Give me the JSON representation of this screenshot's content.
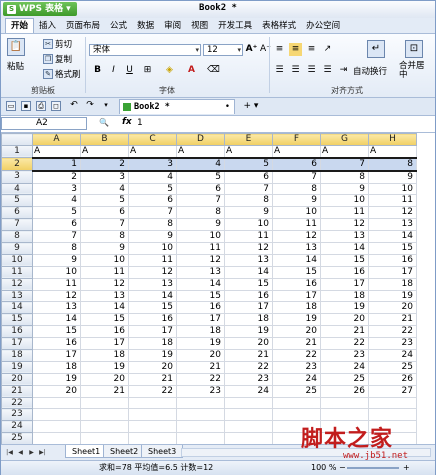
{
  "app": {
    "brand": "WPS 表格",
    "logo_letter": "S",
    "dropdown": "▾",
    "document_title": "Book2 *"
  },
  "menu": [
    "开始",
    "插入",
    "页面布局",
    "公式",
    "数据",
    "审阅",
    "视图",
    "开发工具",
    "表格样式",
    "办公空间"
  ],
  "ribbon": {
    "clipboard": {
      "paste": "粘贴",
      "cut": "剪切",
      "copy": "复制",
      "format_painter": "格式刷",
      "group": "剪贴板"
    },
    "font": {
      "name": "宋体",
      "size": "12",
      "bold": "B",
      "italic": "I",
      "underline": "U",
      "font_color_letter": "A",
      "grow": "A⁺",
      "shrink": "A⁻",
      "group": "字体"
    },
    "alignment": {
      "wrap": "自动换行",
      "merge": "合并居中",
      "group": "对齐方式"
    }
  },
  "doc_tab": {
    "title": "Book2 *",
    "close": "•",
    "new": "+ ▾"
  },
  "formula": {
    "cell_ref": "A2",
    "zoom_icon": "🔍",
    "fx": "fx",
    "value": "1"
  },
  "columns": [
    "A",
    "B",
    "C",
    "D",
    "E",
    "F",
    "G",
    "H"
  ],
  "rows": [
    {
      "n": "1",
      "cells": [
        "A",
        "A",
        "A",
        "A",
        "A",
        "A",
        "A",
        "A"
      ]
    },
    {
      "n": "2",
      "cells": [
        "1",
        "2",
        "3",
        "4",
        "5",
        "6",
        "7",
        "8"
      ]
    },
    {
      "n": "3",
      "cells": [
        "2",
        "3",
        "4",
        "5",
        "6",
        "7",
        "8",
        "9"
      ]
    },
    {
      "n": "4",
      "cells": [
        "3",
        "4",
        "5",
        "6",
        "7",
        "8",
        "9",
        "10"
      ]
    },
    {
      "n": "5",
      "cells": [
        "4",
        "5",
        "6",
        "7",
        "8",
        "9",
        "10",
        "11"
      ]
    },
    {
      "n": "6",
      "cells": [
        "5",
        "6",
        "7",
        "8",
        "9",
        "10",
        "11",
        "12"
      ]
    },
    {
      "n": "7",
      "cells": [
        "6",
        "7",
        "8",
        "9",
        "10",
        "11",
        "12",
        "13"
      ]
    },
    {
      "n": "8",
      "cells": [
        "7",
        "8",
        "9",
        "10",
        "11",
        "12",
        "13",
        "14"
      ]
    },
    {
      "n": "9",
      "cells": [
        "8",
        "9",
        "10",
        "11",
        "12",
        "13",
        "14",
        "15"
      ]
    },
    {
      "n": "10",
      "cells": [
        "9",
        "10",
        "11",
        "12",
        "13",
        "14",
        "15",
        "16"
      ]
    },
    {
      "n": "11",
      "cells": [
        "10",
        "11",
        "12",
        "13",
        "14",
        "15",
        "16",
        "17"
      ]
    },
    {
      "n": "12",
      "cells": [
        "11",
        "12",
        "13",
        "14",
        "15",
        "16",
        "17",
        "18"
      ]
    },
    {
      "n": "13",
      "cells": [
        "12",
        "13",
        "14",
        "15",
        "16",
        "17",
        "18",
        "19"
      ]
    },
    {
      "n": "14",
      "cells": [
        "13",
        "14",
        "15",
        "16",
        "17",
        "18",
        "19",
        "20"
      ]
    },
    {
      "n": "15",
      "cells": [
        "14",
        "15",
        "16",
        "17",
        "18",
        "19",
        "20",
        "21"
      ]
    },
    {
      "n": "16",
      "cells": [
        "15",
        "16",
        "17",
        "18",
        "19",
        "20",
        "21",
        "22"
      ]
    },
    {
      "n": "17",
      "cells": [
        "16",
        "17",
        "18",
        "19",
        "20",
        "21",
        "22",
        "23"
      ]
    },
    {
      "n": "18",
      "cells": [
        "17",
        "18",
        "19",
        "20",
        "21",
        "22",
        "23",
        "24"
      ]
    },
    {
      "n": "19",
      "cells": [
        "18",
        "19",
        "20",
        "21",
        "22",
        "23",
        "24",
        "25"
      ]
    },
    {
      "n": "20",
      "cells": [
        "19",
        "20",
        "21",
        "22",
        "23",
        "24",
        "25",
        "26"
      ]
    },
    {
      "n": "21",
      "cells": [
        "20",
        "21",
        "22",
        "23",
        "24",
        "25",
        "26",
        "27"
      ]
    },
    {
      "n": "22",
      "cells": [
        "",
        "",
        "",
        "",
        "",
        "",
        "",
        ""
      ]
    },
    {
      "n": "23",
      "cells": [
        "",
        "",
        "",
        "",
        "",
        "",
        "",
        ""
      ]
    },
    {
      "n": "24",
      "cells": [
        "",
        "",
        "",
        "",
        "",
        "",
        "",
        ""
      ]
    },
    {
      "n": "25",
      "cells": [
        "",
        "",
        "",
        "",
        "",
        "",
        "",
        ""
      ]
    },
    {
      "n": "26",
      "cells": [
        "",
        "",
        "",
        "",
        "",
        "",
        "",
        ""
      ]
    }
  ],
  "sheets": [
    "Sheet1",
    "Sheet2",
    "Sheet3"
  ],
  "status": {
    "summary": "求和=78  平均值=6.5  计数=12",
    "zoom": "100 %",
    "minus": "−",
    "plus": "+"
  },
  "watermark": {
    "main": "脚本之家",
    "url": "www.jb51.net"
  }
}
